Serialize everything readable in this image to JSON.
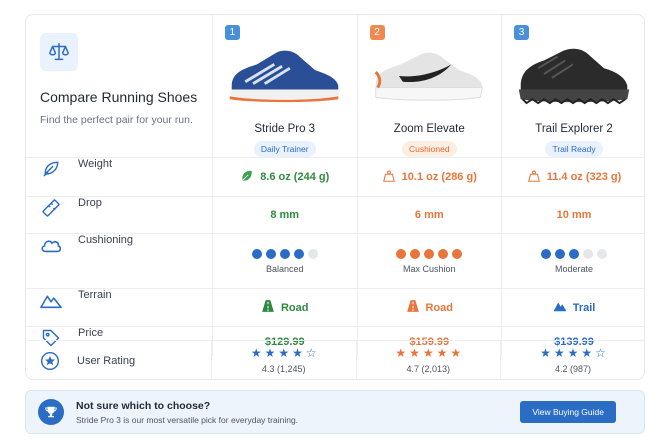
{
  "header": {
    "title": "Compare Running Shoes",
    "subtitle": "Find the perfect pair for your run."
  },
  "shoes": [
    {
      "num": "1",
      "num_color": "#4a90d9",
      "name": "Stride Pro 3",
      "tag": "Daily Trainer",
      "tag_style": "blue"
    },
    {
      "num": "2",
      "num_color": "#f0894f",
      "name": "Zoom Elevate",
      "tag": "Cushioned",
      "tag_style": "orange"
    },
    {
      "num": "3",
      "num_color": "#4a90d9",
      "name": "Trail Explorer 2",
      "tag": "Trail Ready",
      "tag_style": "blue"
    }
  ],
  "rows": {
    "weight": {
      "label": "Weight",
      "values": [
        "8.6 oz (244 g)",
        "10.1 oz (286 g)",
        "11.4 oz (323 g)"
      ]
    },
    "drop": {
      "label": "Drop",
      "values": [
        "8 mm",
        "6 mm",
        "10 mm"
      ]
    },
    "cushioning": {
      "label": "Cushioning",
      "levels": [
        4,
        5,
        3
      ],
      "max": 5,
      "values": [
        "Balanced",
        "Max Cushion",
        "Moderate"
      ]
    },
    "terrain": {
      "label": "Terrain",
      "values": [
        "Road",
        "Road",
        "Trail"
      ]
    },
    "price": {
      "label": "Price",
      "values": [
        "$129.99",
        "$159.99",
        "$139.99"
      ]
    },
    "rating": {
      "label": "User Rating",
      "stars": [
        4,
        5,
        4
      ],
      "values": [
        "4.3 (1,245)",
        "4.7 (2,013)",
        "4.2 (987)"
      ]
    }
  },
  "footer": {
    "title": "Not sure which to choose?",
    "subtitle": "Stride Pro 3 is our most versatile pick for everyday training.",
    "button": "View Buying Guide"
  },
  "colors": {
    "accent_blue": "#2b6cc4",
    "accent_orange": "#e8763a",
    "accent_green": "#2e8b3e",
    "dot_empty": "#e5e7eb"
  }
}
